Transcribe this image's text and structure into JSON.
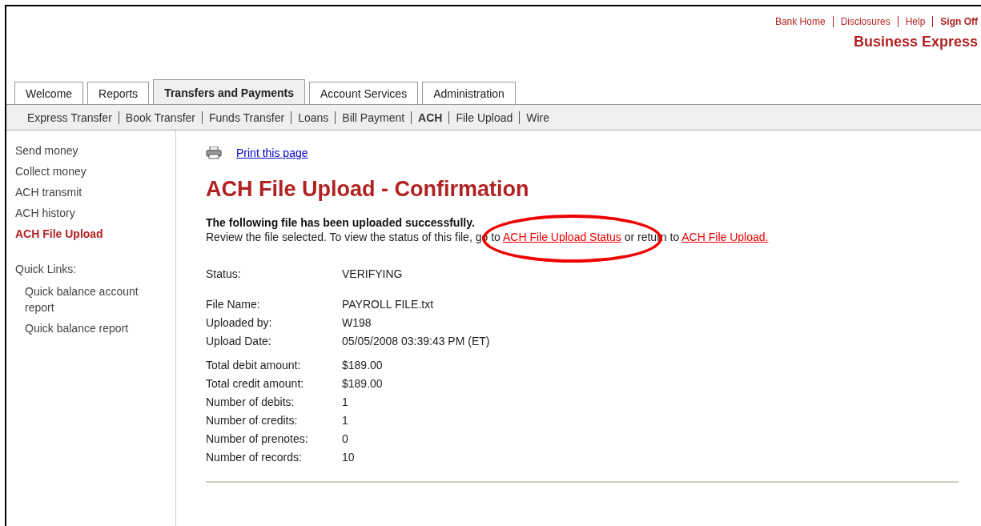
{
  "header": {
    "links": [
      {
        "label": "Bank Home",
        "bold": false
      },
      {
        "label": "Disclosures",
        "bold": false
      },
      {
        "label": "Help",
        "bold": false
      },
      {
        "label": "Sign Off",
        "bold": true
      }
    ],
    "brand": "Business Express"
  },
  "tabs": [
    {
      "label": "Welcome",
      "selected": false
    },
    {
      "label": "Reports",
      "selected": false
    },
    {
      "label": "Transfers and Payments",
      "selected": true
    },
    {
      "label": "Account Services",
      "selected": false
    },
    {
      "label": "Administration",
      "selected": false
    }
  ],
  "subnav": [
    {
      "label": "Express Transfer",
      "selected": false
    },
    {
      "label": "Book Transfer",
      "selected": false
    },
    {
      "label": "Funds Transfer",
      "selected": false
    },
    {
      "label": "Loans",
      "selected": false
    },
    {
      "label": "Bill Payment",
      "selected": false
    },
    {
      "label": "ACH",
      "selected": true
    },
    {
      "label": "File Upload",
      "selected": false
    },
    {
      "label": "Wire",
      "selected": false
    }
  ],
  "sidebar": {
    "items": [
      {
        "label": "Send money",
        "selected": false
      },
      {
        "label": "Collect money",
        "selected": false
      },
      {
        "label": "ACH transmit",
        "selected": false
      },
      {
        "label": "ACH history",
        "selected": false
      },
      {
        "label": "ACH File Upload",
        "selected": true
      }
    ],
    "quick_links_title": "Quick Links:",
    "quick_links": [
      "Quick balance account report",
      "Quick balance report"
    ]
  },
  "print_link": "Print this page",
  "title": "ACH File Upload - Confirmation",
  "message": "The following file has been uploaded successfully.",
  "instructions": [
    {
      "kind": "text",
      "text": "Review the file selected. To view the status of this file, go to "
    },
    {
      "kind": "link",
      "text": "ACH File Upload Status",
      "circled": true
    },
    {
      "kind": "text",
      "text": " or return to "
    },
    {
      "kind": "link",
      "text": "ACH File Upload.",
      "circled": false
    }
  ],
  "details": [
    [
      {
        "label": "Status:",
        "value": "VERIFYING"
      }
    ],
    [
      {
        "label": "File Name:",
        "value": "PAYROLL FILE.txt"
      },
      {
        "label": "Uploaded by:",
        "value": "W198"
      },
      {
        "label": "Upload Date:",
        "value": "05/05/2008 03:39:43 PM (ET)"
      }
    ],
    [
      {
        "label": "Total debit amount:",
        "value": "$189.00"
      },
      {
        "label": "Total credit amount:",
        "value": "$189.00"
      },
      {
        "label": "Number of debits:",
        "value": "1"
      },
      {
        "label": "Number of credits:",
        "value": "1"
      },
      {
        "label": "Number of prenotes:",
        "value": "0"
      },
      {
        "label": "Number of records:",
        "value": "10"
      }
    ]
  ]
}
